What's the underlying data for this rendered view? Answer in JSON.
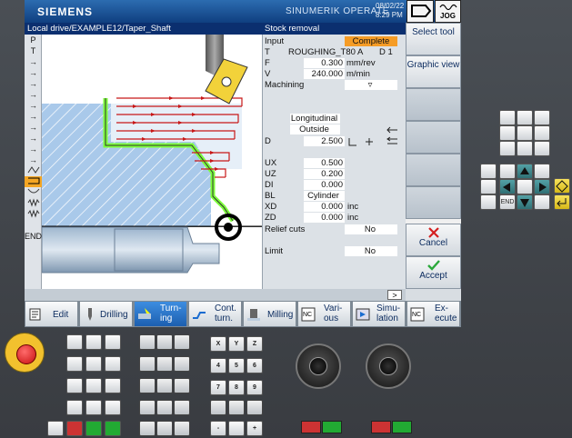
{
  "window": {
    "brand": "SIEMENS",
    "product": "SINUMERIK OPERATE",
    "date": "08/02/22",
    "time": "8:29 PM",
    "mode": "JOG"
  },
  "header": {
    "path": "Local drive/EXAMPLE12/Taper_Shaft",
    "cycle": "Stock removal"
  },
  "left_tools": [
    "P",
    "T",
    "→",
    "→",
    "→",
    "→",
    "→",
    "→",
    "→",
    "→",
    "→",
    "→",
    "",
    "",
    "",
    "",
    "",
    "",
    "END"
  ],
  "form": {
    "input_label": "Input",
    "input_value": "Complete",
    "t_label": "T",
    "t_value": "ROUGHING_T80 A",
    "d_value": "D 1",
    "f_label": "F",
    "f_value": "0.300",
    "f_unit": "mm/rev",
    "v_label": "V",
    "v_value": "240.000",
    "v_unit": "m/min",
    "machining_label": "Machining",
    "machining_value": "▿",
    "direction": "Longitudinal",
    "position": "Outside",
    "d_label": "D",
    "d_value2": "2.500",
    "ux_label": "UX",
    "ux_value": "0.500",
    "uz_label": "UZ",
    "uz_value": "0.200",
    "di_label": "DI",
    "di_value": "0.000",
    "bl_label": "BL",
    "bl_value": "Cylinder",
    "xd_label": "XD",
    "xd_value": "0.000",
    "xd_unit": "inc",
    "zd_label": "ZD",
    "zd_value": "0.000",
    "zd_unit": "inc",
    "relief_label": "Relief cuts",
    "relief_value": "No",
    "limit_label": "Limit",
    "limit_value": "No"
  },
  "right_softkeys": {
    "select_tool": "Select tool",
    "graphic_view": "Graphic view",
    "cancel": "Cancel",
    "accept": "Accept"
  },
  "bottom_softkeys": [
    {
      "label": "Edit"
    },
    {
      "label": "Drilling"
    },
    {
      "label": "Turn- ing"
    },
    {
      "label": "Cont. turn."
    },
    {
      "label": "Milling"
    },
    {
      "label": "Vari- ous"
    },
    {
      "label": "Simu- lation"
    },
    {
      "label": "Ex- ecute"
    }
  ],
  "scroll_label": ">",
  "keypad_xyz": [
    "X",
    "Y",
    "Z",
    "4",
    "5",
    "6",
    "7",
    "8",
    "9",
    "-",
    "+"
  ],
  "colors": {
    "accent": "#f59c26",
    "header": "#0b2f6f",
    "active_softkey": "#2a77c9",
    "contour": "#7cff3a"
  }
}
